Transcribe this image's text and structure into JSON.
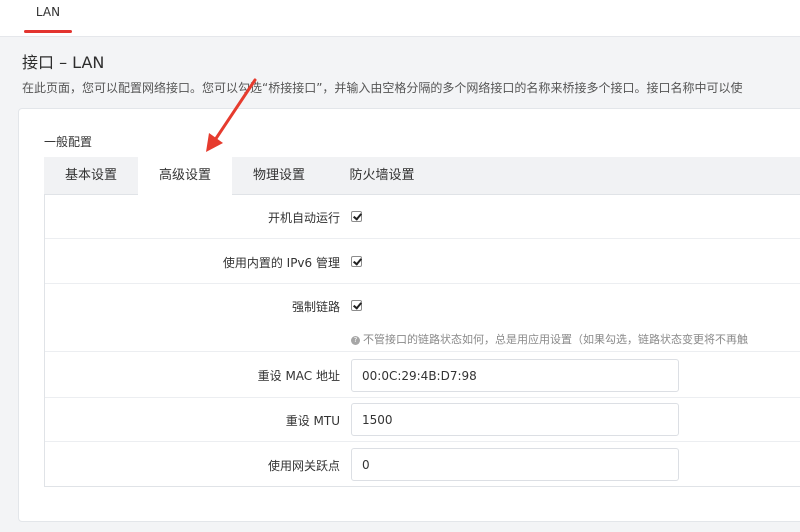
{
  "top_tab": {
    "label": "LAN"
  },
  "page": {
    "title": "接口 – LAN",
    "description": "在此页面，您可以配置网络接口。您可以勾选“桥接接口”，并输入由空格分隔的多个网络接口的名称来桥接多个接口。接口名称中可以使"
  },
  "section": {
    "label": "一般配置"
  },
  "tabs": [
    {
      "label": "基本设置",
      "active": false
    },
    {
      "label": "高级设置",
      "active": true
    },
    {
      "label": "物理设置",
      "active": false
    },
    {
      "label": "防火墙设置",
      "active": false
    }
  ],
  "fields": {
    "autostart": {
      "label": "开机自动运行",
      "checked": true
    },
    "ipv6": {
      "label": "使用内置的 IPv6 管理",
      "checked": true
    },
    "force_link": {
      "label": "强制链路",
      "checked": true,
      "help": "不管接口的链路状态如何，总是用应用设置（如果勾选，链路状态变更将不再触"
    },
    "mac": {
      "label": "重设 MAC 地址",
      "value": "00:0C:29:4B:D7:98"
    },
    "mtu": {
      "label": "重设 MTU",
      "value": "1500"
    },
    "metric": {
      "label": "使用网关跃点",
      "value": "0"
    }
  },
  "colors": {
    "accent": "#e3342f",
    "annotation_arrow": "#e63b2e"
  }
}
